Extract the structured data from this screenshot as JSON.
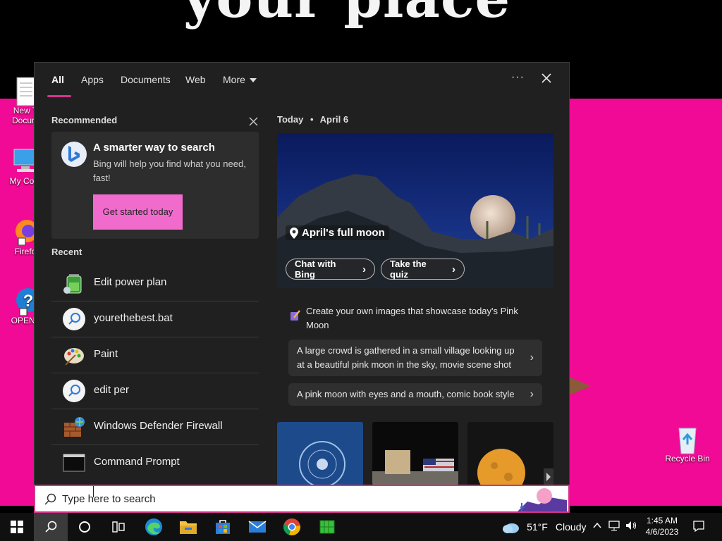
{
  "wallpaper": {
    "title": "your place"
  },
  "desktop": {
    "icons": [
      {
        "label": "New T\nDocum"
      },
      {
        "label": "My Com"
      },
      {
        "label": "Firefo"
      },
      {
        "label": "OPEN I"
      },
      {
        "label": "Recycle Bin"
      }
    ]
  },
  "search_panel": {
    "tabs": [
      {
        "label": "All"
      },
      {
        "label": "Apps"
      },
      {
        "label": "Documents"
      },
      {
        "label": "Web"
      },
      {
        "label": "More"
      }
    ],
    "more_options": "···",
    "recommended": {
      "heading": "Recommended",
      "card_title": "A smarter way to search",
      "card_desc": "Bing will help you find what you need, fast!",
      "card_button": "Get started today"
    },
    "recent": {
      "heading": "Recent",
      "items": [
        {
          "name": "Edit power plan",
          "icon": "battery-icon"
        },
        {
          "name": "yourethebest.bat",
          "icon": "search-result-icon"
        },
        {
          "name": "Paint",
          "icon": "paint-palette-icon"
        },
        {
          "name": "edit per",
          "icon": "search-result-icon"
        },
        {
          "name": "Windows Defender Firewall",
          "icon": "firewall-icon"
        },
        {
          "name": "Command Prompt",
          "icon": "terminal-icon"
        }
      ]
    },
    "today": {
      "label": "Today",
      "separator": "•",
      "date": "April 6",
      "hero_caption": "April's full moon",
      "chat_button": "Chat with Bing",
      "quiz_button": "Take the quiz",
      "create_heading": "Create your own images that showcase today's Pink Moon",
      "prompts": [
        "A large crowd is gathered in a small village looking up at a beautiful pink moon in the sky, movie scene shot",
        "A pink moon with eyes and a mouth, comic book style"
      ]
    }
  },
  "search_box": {
    "placeholder": "Type here to search"
  },
  "taskbar": {
    "weather_temp": "51°F",
    "weather_text": "Cloudy",
    "time": "1:45 AM",
    "date": "4/6/2023"
  },
  "colors": {
    "accent": "#d7338b",
    "wallpaper": "#f10a95",
    "button": "#f16bcd"
  }
}
